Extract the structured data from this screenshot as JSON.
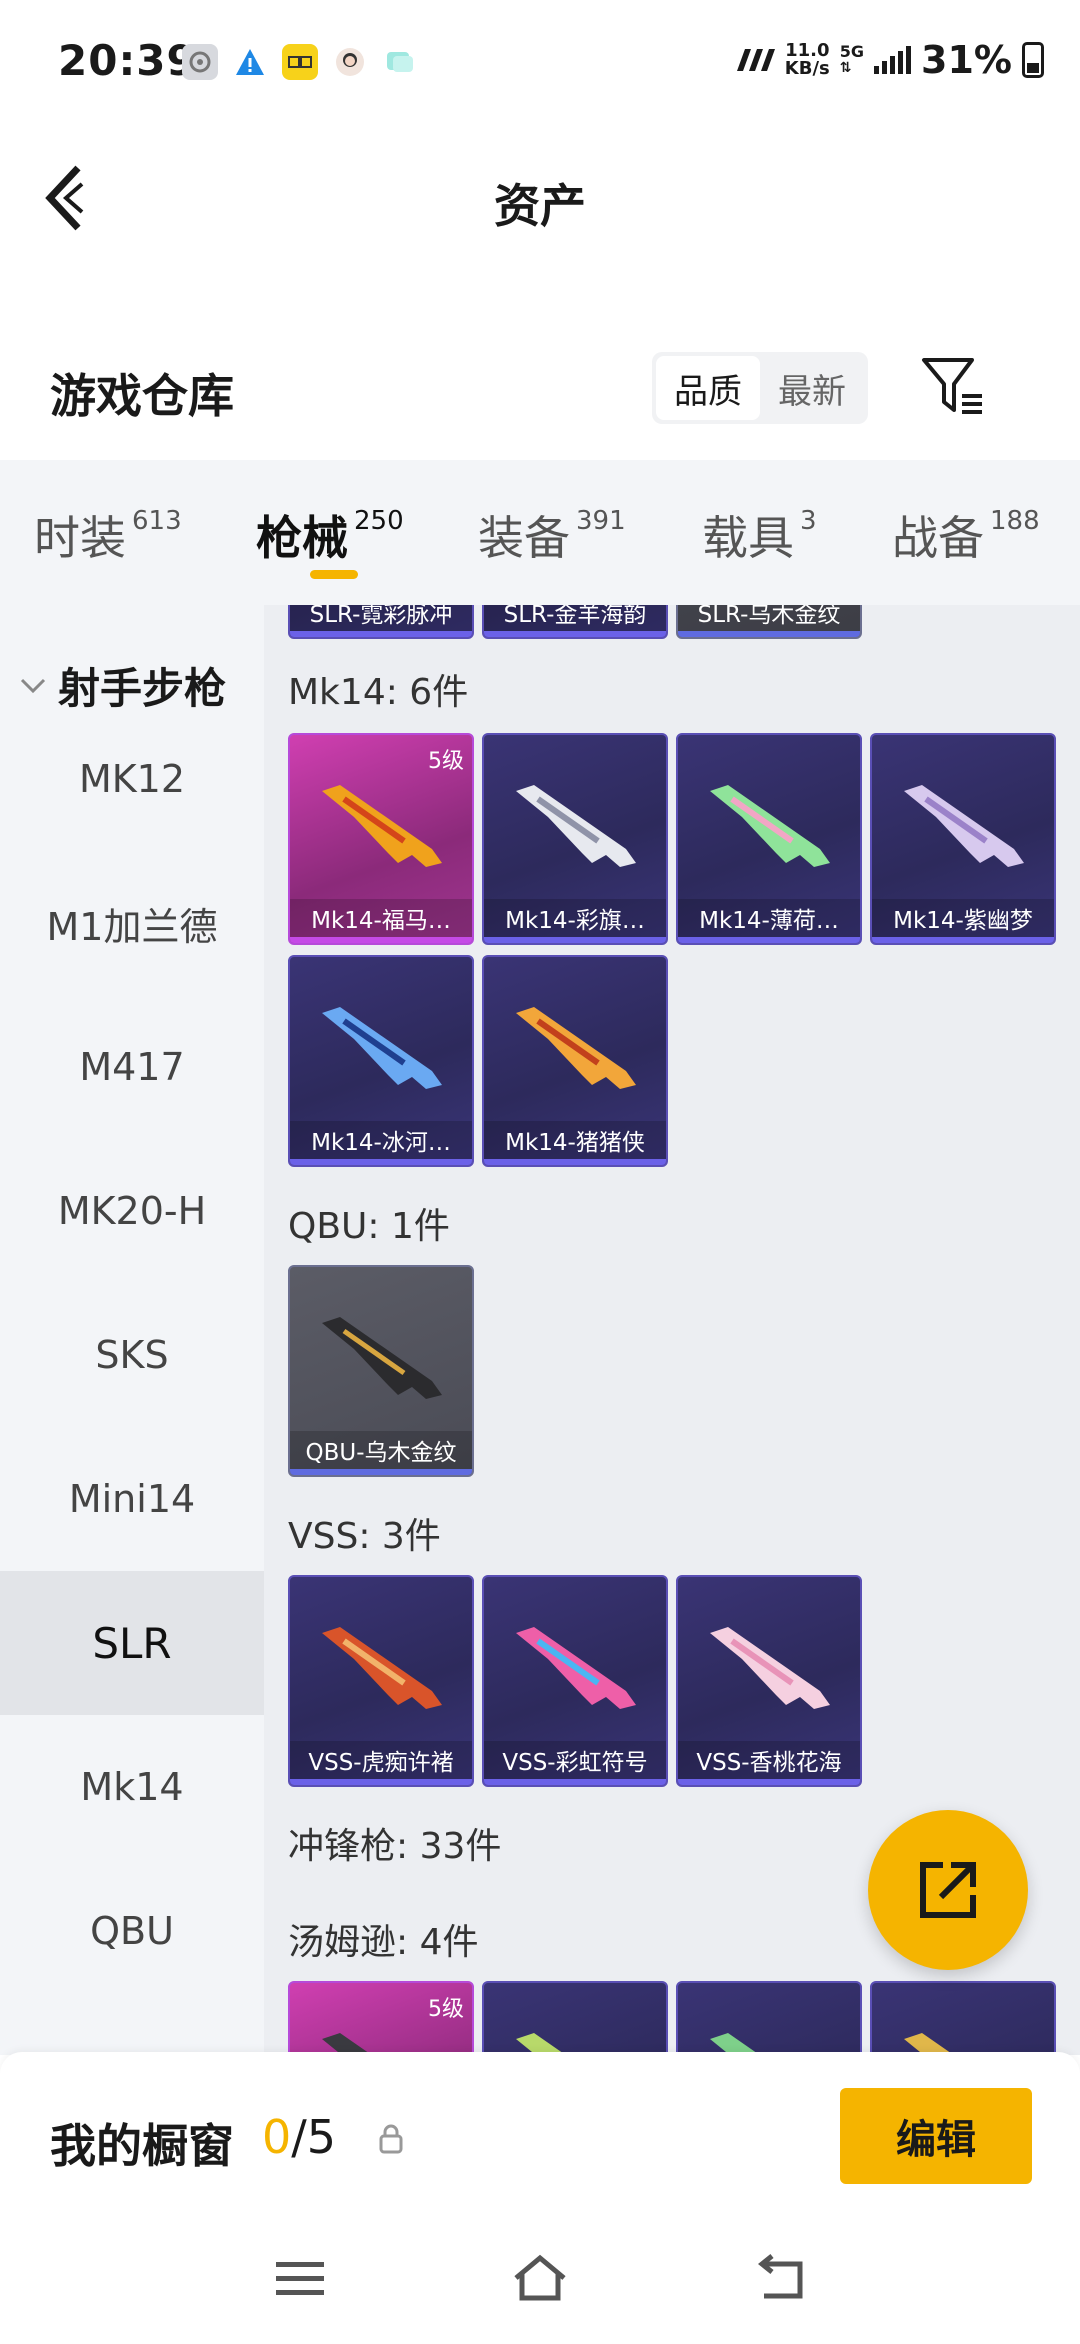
{
  "status_bar": {
    "time": "20:39",
    "net_speed_value": "11.0",
    "net_speed_unit": "KB/s",
    "network": "5G",
    "battery": "31%"
  },
  "header": {
    "title": "资产"
  },
  "warehouse": {
    "title": "游戏仓库",
    "sort_options": [
      "品质",
      "最新"
    ],
    "selected_sort": "品质"
  },
  "tabs": [
    {
      "label": "时装",
      "count": "613"
    },
    {
      "label": "枪械",
      "count": "250"
    },
    {
      "label": "装备",
      "count": "391"
    },
    {
      "label": "载具",
      "count": "3"
    },
    {
      "label": "战备",
      "count": "188"
    }
  ],
  "active_tab": "枪械",
  "sidebar": {
    "group": "射手步枪",
    "items": [
      "MK12",
      "M1加兰德",
      "M417",
      "MK20-H",
      "SKS",
      "Mini14",
      "SLR",
      "Mk14",
      "QBU"
    ],
    "active": "SLR"
  },
  "content": {
    "top_partial": [
      "SLR-霓彩脉冲",
      "SLR-金羊海韵",
      "SLR-乌木金纹"
    ],
    "sections": [
      {
        "title": "Mk14: 6件",
        "items": [
          {
            "name": "Mk14-福马…",
            "level": "5级",
            "rarity": "pink"
          },
          {
            "name": "Mk14-彩旗…",
            "rarity": "purple"
          },
          {
            "name": "Mk14-薄荷…",
            "rarity": "purple"
          },
          {
            "name": "Mk14-紫幽梦",
            "rarity": "purple"
          },
          {
            "name": "Mk14-冰河…",
            "rarity": "purple"
          },
          {
            "name": "Mk14-猪猪侠",
            "rarity": "purple"
          }
        ]
      },
      {
        "title": "QBU: 1件",
        "items": [
          {
            "name": "QBU-乌木金纹",
            "rarity": "gray"
          }
        ]
      },
      {
        "title": "VSS: 3件",
        "items": [
          {
            "name": "VSS-虎痴许褚",
            "rarity": "purple"
          },
          {
            "name": "VSS-彩虹符号",
            "rarity": "purple"
          },
          {
            "name": "VSS-香桃花海",
            "rarity": "purple"
          }
        ]
      },
      {
        "title": "冲锋枪: 33件"
      },
      {
        "title": "汤姆逊: 4件",
        "items": [
          {
            "level": "5级",
            "rarity": "pink"
          },
          {
            "rarity": "purple"
          },
          {
            "rarity": "purple"
          },
          {
            "rarity": "purple"
          }
        ]
      }
    ]
  },
  "showcase": {
    "label": "我的橱窗",
    "current": "0",
    "total": "/5",
    "edit_label": "编辑"
  },
  "colors": {
    "accent": "#f5b400",
    "card_purple": "#3a3475",
    "card_pink": "#d03fb1",
    "card_gray": "#5b5c66"
  }
}
